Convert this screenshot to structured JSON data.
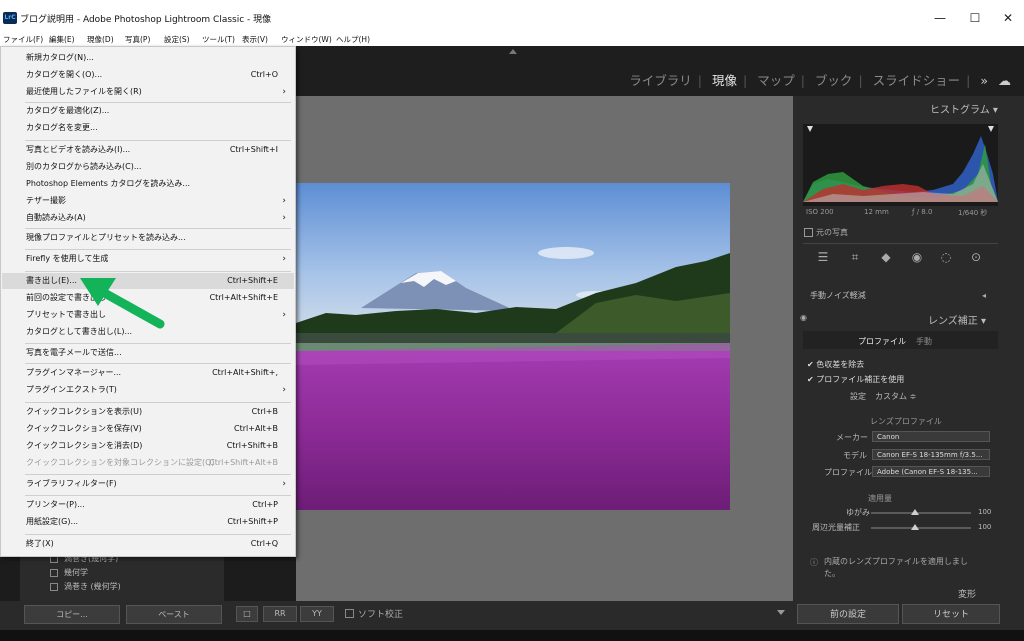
{
  "window": {
    "app_icon": "LrC",
    "title": "ブログ説明用 - Adobe Photoshop Lightroom Classic - 現像",
    "minimize": "—",
    "maximize": "☐",
    "close": "✕"
  },
  "menubar": [
    "ファイル(F)",
    "編集(E)",
    "現像(D)",
    "写真(P)",
    "設定(S)",
    "ツール(T)",
    "表示(V)",
    "ウィンドウ(W)",
    "ヘルプ(H)"
  ],
  "modules": {
    "items": [
      "ライブラリ",
      "現像",
      "マップ",
      "ブック",
      "スライドショー"
    ],
    "active": "現像",
    "more": "»"
  },
  "file_menu": {
    "items": [
      {
        "label": "新規カタログ(N)...",
        "shortcut": "",
        "submenu": false
      },
      {
        "label": "カタログを開く(O)...",
        "shortcut": "Ctrl+O",
        "submenu": false
      },
      {
        "label": "最近使用したファイルを開く(R)",
        "shortcut": "",
        "submenu": true
      },
      {
        "label": "カタログを最適化(Z)...",
        "shortcut": "",
        "submenu": false
      },
      {
        "label": "カタログ名を変更...",
        "shortcut": "",
        "submenu": false
      },
      {
        "label": "写真とビデオを読み込み(I)...",
        "shortcut": "Ctrl+Shift+I",
        "submenu": false
      },
      {
        "label": "別のカタログから読み込み(C)...",
        "shortcut": "",
        "submenu": false
      },
      {
        "label": "Photoshop Elements カタログを読み込み...",
        "shortcut": "",
        "submenu": false
      },
      {
        "label": "テザー撮影",
        "shortcut": "",
        "submenu": true
      },
      {
        "label": "自動読み込み(A)",
        "shortcut": "",
        "submenu": true
      },
      {
        "label": "現像プロファイルとプリセットを読み込み...",
        "shortcut": "",
        "submenu": false
      },
      {
        "label": "Firefly を使用して生成",
        "shortcut": "",
        "submenu": true
      },
      {
        "label": "書き出し(E)...",
        "shortcut": "Ctrl+Shift+E",
        "submenu": false,
        "highlighted": true
      },
      {
        "label": "前回の設定で書き出し",
        "shortcut": "Ctrl+Alt+Shift+E",
        "submenu": false
      },
      {
        "label": "プリセットで書き出し",
        "shortcut": "",
        "submenu": true
      },
      {
        "label": "カタログとして書き出し(L)...",
        "shortcut": "",
        "submenu": false
      },
      {
        "label": "写真を電子メールで送信...",
        "shortcut": "",
        "submenu": false
      },
      {
        "label": "プラグインマネージャー...",
        "shortcut": "Ctrl+Alt+Shift+,",
        "submenu": false
      },
      {
        "label": "プラグインエクストラ(T)",
        "shortcut": "",
        "submenu": true
      },
      {
        "label": "クイックコレクションを表示(U)",
        "shortcut": "Ctrl+B",
        "submenu": false
      },
      {
        "label": "クイックコレクションを保存(V)",
        "shortcut": "Ctrl+Alt+B",
        "submenu": false
      },
      {
        "label": "クイックコレクションを消去(D)",
        "shortcut": "Ctrl+Shift+B",
        "submenu": false
      },
      {
        "label": "クイックコレクションを対象コレクションに設定(Q)",
        "shortcut": "Ctrl+Shift+Alt+B",
        "submenu": false,
        "disabled": true
      },
      {
        "label": "ライブラリフィルター(F)",
        "shortcut": "",
        "submenu": true
      },
      {
        "label": "プリンター(P)...",
        "shortcut": "Ctrl+P",
        "submenu": false
      },
      {
        "label": "用紙設定(G)...",
        "shortcut": "Ctrl+Shift+P",
        "submenu": false
      },
      {
        "label": "終了(X)",
        "shortcut": "Ctrl+Q",
        "submenu": false
      }
    ]
  },
  "left_panel": {
    "tree": [
      "渦巻き(幾何学)",
      "幾何学",
      "渦巻き (幾何学)"
    ],
    "copy": "コピー...",
    "paste": "ペースト"
  },
  "toolbar": {
    "view1": "□",
    "view2": "RR",
    "view3": "YY",
    "soft_proof_label": "ソフト校正"
  },
  "right_panel": {
    "histogram_title": "ヒストグラム",
    "exif": {
      "iso": "ISO 200",
      "focal": "12 mm",
      "aperture": "ƒ / 8.0",
      "shutter": "1/640 秒"
    },
    "original_photo": "元の写真",
    "noise_section": "手動ノイズ軽減",
    "lens_section": "レンズ補正",
    "tabs": [
      "プロファイル",
      "手動"
    ],
    "active_tab": "プロファイル",
    "remove_ca": "色収差を除去",
    "enable_profile": "プロファイル補正を使用",
    "setup_label": "設定",
    "setup_value": "カスタム ≑",
    "lens_profile_title": "レンズプロファイル",
    "maker_label": "メーカー",
    "maker_value": "Canon",
    "model_label": "モデル",
    "model_value": "Canon EF-S 18-135mm f/3.5...",
    "profile_label": "プロファイル",
    "profile_value": "Adobe (Canon EF-S 18-135...",
    "amount_title": "適用量",
    "distortion_label": "ゆがみ",
    "distortion_value": "100",
    "distortion_level": 0.5,
    "vignette_label": "周辺光量補正",
    "vignette_value": "100",
    "vignette_level": 0.5,
    "builtin_note": "内蔵のレンズプロファイルを適用しました。",
    "transform_section": "変形",
    "prev_button": "前の設定",
    "reset_button": "リセット"
  }
}
